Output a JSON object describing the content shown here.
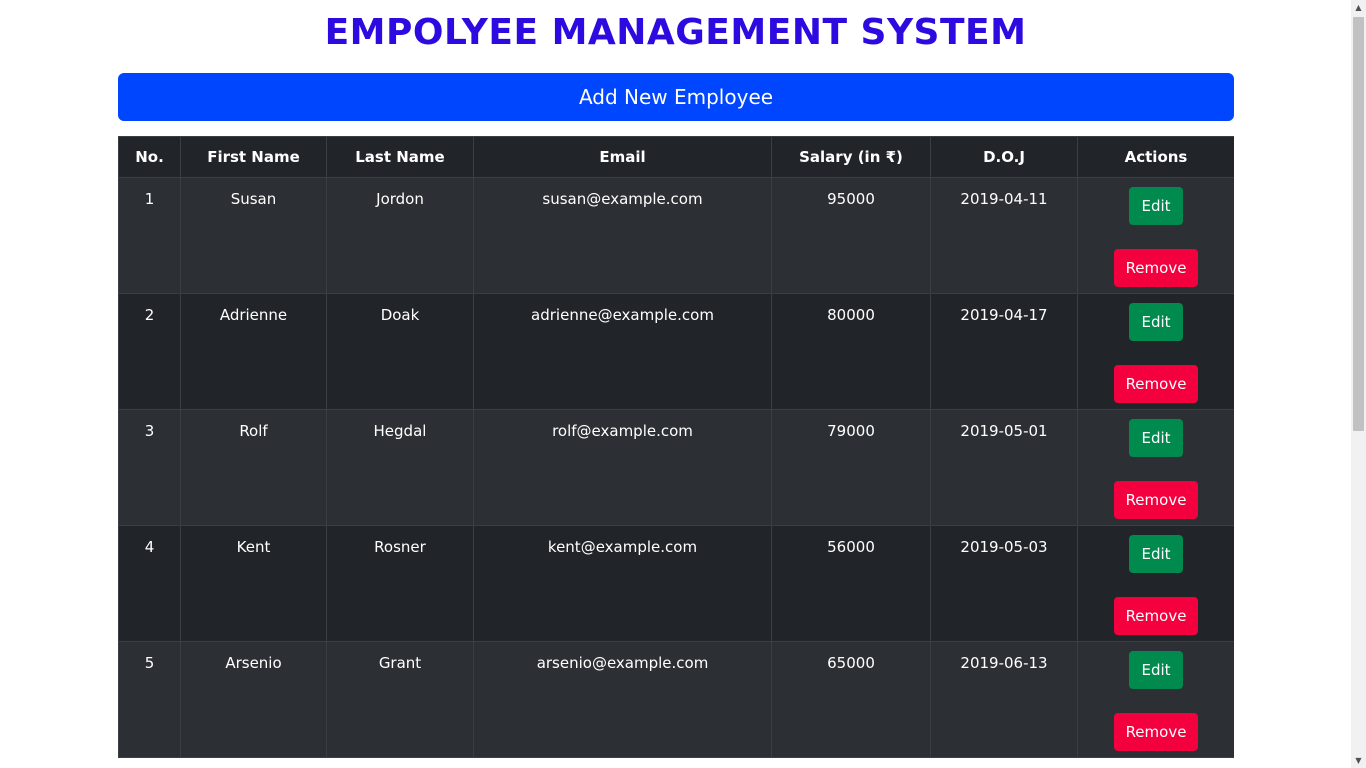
{
  "header": {
    "title": "EMPOLYEE MANAGEMENT SYSTEM",
    "add_button_label": "Add New Employee"
  },
  "table": {
    "columns": [
      "No.",
      "First Name",
      "Last Name",
      "Email",
      "Salary (in ₹)",
      "D.O.J",
      "Actions"
    ],
    "rows": [
      {
        "no": "1",
        "first": "Susan",
        "last": "Jordon",
        "email": "susan@example.com",
        "salary": "95000",
        "doj": "2019-04-11"
      },
      {
        "no": "2",
        "first": "Adrienne",
        "last": "Doak",
        "email": "adrienne@example.com",
        "salary": "80000",
        "doj": "2019-04-17"
      },
      {
        "no": "3",
        "first": "Rolf",
        "last": "Hegdal",
        "email": "rolf@example.com",
        "salary": "79000",
        "doj": "2019-05-01"
      },
      {
        "no": "4",
        "first": "Kent",
        "last": "Rosner",
        "email": "kent@example.com",
        "salary": "56000",
        "doj": "2019-05-03"
      },
      {
        "no": "5",
        "first": "Arsenio",
        "last": "Grant",
        "email": "arsenio@example.com",
        "salary": "65000",
        "doj": "2019-06-13"
      }
    ],
    "edit_label": "Edit",
    "remove_label": "Remove"
  },
  "colors": {
    "title": "#2c0ae0",
    "add_button": "#0046ff",
    "edit_button": "#008a4e",
    "remove_button": "#f5003f",
    "table_dark": "#212529",
    "table_stripe": "#2c3034"
  },
  "icons": {
    "scroll_up": "▲",
    "scroll_down": "▼"
  }
}
